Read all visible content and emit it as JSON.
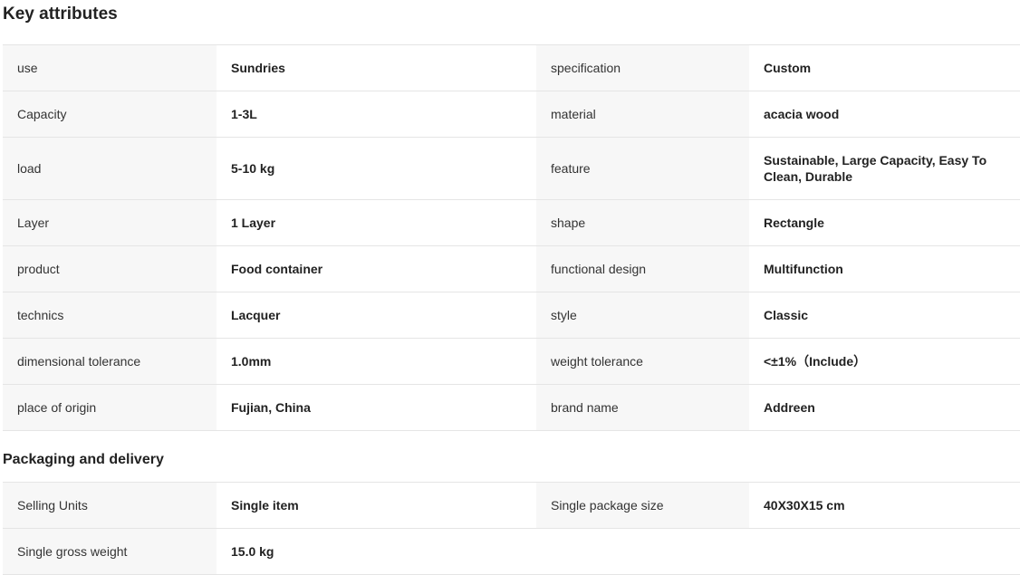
{
  "key_attributes": {
    "title": "Key attributes",
    "rows": [
      {
        "k1": "use",
        "v1": "Sundries",
        "k2": "specification",
        "v2": "Custom"
      },
      {
        "k1": "Capacity",
        "v1": "1-3L",
        "k2": "material",
        "v2": "acacia wood"
      },
      {
        "k1": "load",
        "v1": "5-10 kg",
        "k2": "feature",
        "v2": "Sustainable, Large Capacity, Easy To Clean, Durable"
      },
      {
        "k1": "Layer",
        "v1": "1 Layer",
        "k2": "shape",
        "v2": "Rectangle"
      },
      {
        "k1": "product",
        "v1": "Food container",
        "k2": "functional design",
        "v2": "Multifunction"
      },
      {
        "k1": "technics",
        "v1": "Lacquer",
        "k2": "style",
        "v2": "Classic"
      },
      {
        "k1": "dimensional tolerance",
        "v1": "1.0mm",
        "k2": "weight tolerance",
        "v2": "<±1%（Include）"
      },
      {
        "k1": "place of origin",
        "v1": "Fujian, China",
        "k2": "brand name",
        "v2": "Addreen"
      }
    ]
  },
  "packaging": {
    "title": "Packaging and delivery",
    "rows": [
      {
        "k1": "Selling Units",
        "v1": "Single item",
        "k2": "Single package size",
        "v2": "40X30X15 cm"
      },
      {
        "k1": "Single gross weight",
        "v1": "15.0 kg",
        "k2": "",
        "v2": ""
      }
    ]
  }
}
